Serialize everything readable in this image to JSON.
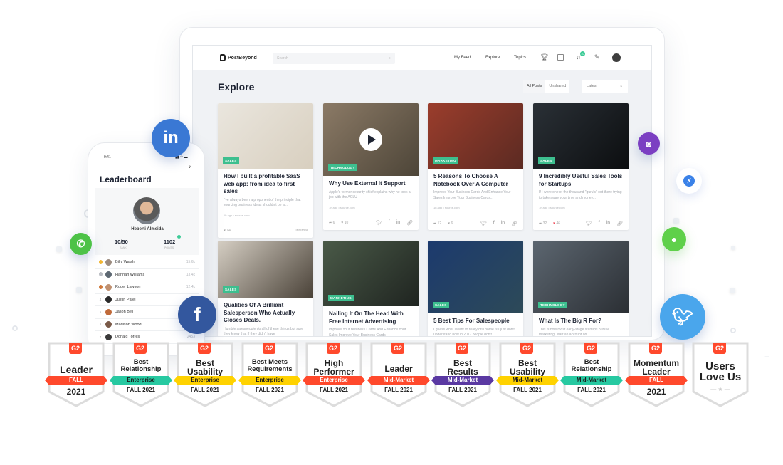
{
  "app": {
    "brand": "PostBeyond",
    "search_placeholder": "Search",
    "nav": [
      "My Feed",
      "Explore",
      "Topics"
    ],
    "notification_count": "10",
    "icons": [
      "trophy-icon",
      "calendar-icon",
      "bell-icon",
      "compose-icon",
      "user-avatar"
    ]
  },
  "explore": {
    "title": "Explore",
    "filters": [
      "All Posts",
      "Unshared"
    ],
    "active_filter": "All Posts",
    "sort": "Latest"
  },
  "cards": [
    {
      "tag": "SALES",
      "title": "How I built a profitable SaaS web app: from idea to first sales",
      "desc": "I've always been a proponent of the principle that sourcing business ideas shouldn't be a ...",
      "meta": "1h ago • source.com",
      "shares": "",
      "likes": "14",
      "right": "Internal",
      "colors": [
        "#eae6de",
        "#d8cfbf"
      ]
    },
    {
      "tag": "TECHNOLOGY",
      "title": "Why Use External It Support",
      "desc": "Apple's former security chief explains why he took a job with the ACLU",
      "meta": "1h ago • source.com",
      "shares": "6",
      "likes": "10",
      "video": true,
      "colors": [
        "#8b7a66",
        "#4d4538"
      ]
    },
    {
      "tag": "MARKETING",
      "title": "5 Reasons To Choose A Notebook Over A Computer",
      "desc": "Improve Your Business Cards And Enhance Your Sales Improve Your Business Cards...",
      "meta": "1h ago • source.com",
      "shares": "12",
      "likes": "6",
      "colors": [
        "#9b3d2c",
        "#5b2a22"
      ]
    },
    {
      "tag": "SALES",
      "title": "9 Incredibly Useful Sales Tools for Startups",
      "desc": "If I were one of the thousand \"guru's\" out there trying to take away your time and money...",
      "meta": "1h ago • source.com",
      "shares": "32",
      "likes": "46",
      "liked": true,
      "colors": [
        "#2a3036",
        "#0c0e10"
      ]
    },
    {
      "tag": "SALES",
      "title": "Qualities Of A Brilliant Salesperson Who Actually Closes Deals.",
      "desc": "Humble salespeople do all of these things but sure they know that if they didn't have",
      "colors": [
        "#d6cfc4",
        "#4a4238"
      ]
    },
    {
      "tag": "MARKETING",
      "title": "Nailing It On The Head With Free Internet Advertising",
      "desc": "Improve Your Business Cards And Enhance Your Sales Improve Your Business Cards",
      "colors": [
        "#4a5a48",
        "#1f2420"
      ]
    },
    {
      "tag": "SALES",
      "title": "5 Best Tips For Salespeople",
      "desc": "I guess what I want to really drill home is I just don't understand how in 2017 people don't",
      "colors": [
        "#1c3a6e",
        "#2d4a58"
      ]
    },
    {
      "tag": "TECHNOLOGY",
      "title": "What Is The Big R For?",
      "desc": "This is how most early-stage startups pursue marketing: start an account on",
      "colors": [
        "#5c6670",
        "#2b2f34"
      ]
    }
  ],
  "phone": {
    "time": "9:41",
    "title": "Leaderboard",
    "user": {
      "name": "Heberti Almeida",
      "rank": "10/50",
      "rank_label": "RANK",
      "points": "1102",
      "points_label": "POINTS"
    },
    "rows": [
      {
        "rank": "1",
        "name": "Billy Walsh",
        "points": "15.6k",
        "medal": "#f2b632"
      },
      {
        "rank": "2",
        "name": "Hannah Williams",
        "points": "13.4k",
        "medal": "#b9bcc2"
      },
      {
        "rank": "3",
        "name": "Roger Lawson",
        "points": "12.4k",
        "medal": "#d07a3c"
      },
      {
        "rank": "4",
        "name": "Justin Patel",
        "points": ""
      },
      {
        "rank": "5",
        "name": "Jason Bell",
        "points": ""
      },
      {
        "rank": "6",
        "name": "Madison Wood",
        "points": ""
      },
      {
        "rank": "7",
        "name": "Donald Torres",
        "points": "2453"
      }
    ]
  },
  "social": [
    "linkedin",
    "instagram",
    "messenger",
    "whatsapp",
    "imessage",
    "facebook",
    "twitter"
  ],
  "badges": [
    {
      "lines": [
        "Leader"
      ],
      "band": "FALL",
      "band_color": "#ff492c",
      "band_text": "#fff",
      "season": "2021",
      "big": true
    },
    {
      "lines": [
        "Best",
        "Relationship"
      ],
      "band": "Enterprise",
      "band_color": "#27c9a1",
      "band_text": "#1a1a1a",
      "season": "FALL 2021"
    },
    {
      "lines": [
        "Best",
        "Usability"
      ],
      "band": "Enterprise",
      "band_color": "#ffd200",
      "band_text": "#1a1a1a",
      "season": "FALL 2021"
    },
    {
      "lines": [
        "Best Meets",
        "Requirements"
      ],
      "band": "Enterprise",
      "band_color": "#ffd200",
      "band_text": "#1a1a1a",
      "season": "FALL 2021"
    },
    {
      "lines": [
        "High",
        "Performer"
      ],
      "band": "Enterprise",
      "band_color": "#ff492c",
      "band_text": "#fff",
      "season": "FALL 2021"
    },
    {
      "lines": [
        "Leader"
      ],
      "band": "Mid-Market",
      "band_color": "#ff492c",
      "band_text": "#fff",
      "season": "FALL 2021"
    },
    {
      "lines": [
        "Best",
        "Results"
      ],
      "band": "Mid-Market",
      "band_color": "#5a39a2",
      "band_text": "#fff",
      "season": "FALL 2021"
    },
    {
      "lines": [
        "Best",
        "Usability"
      ],
      "band": "Mid-Market",
      "band_color": "#ffd200",
      "band_text": "#1a1a1a",
      "season": "FALL 2021"
    },
    {
      "lines": [
        "Best",
        "Relationship"
      ],
      "band": "Mid-Market",
      "band_color": "#27c9a1",
      "band_text": "#1a1a1a",
      "season": "FALL 2021"
    },
    {
      "lines": [
        "Momentum",
        "Leader"
      ],
      "band": "FALL",
      "band_color": "#ff492c",
      "band_text": "#fff",
      "season": "2021",
      "big": true
    },
    {
      "lines": [
        "Users",
        "Love Us"
      ],
      "band": "",
      "season": "",
      "users": true
    }
  ],
  "g2_logo": "G2"
}
